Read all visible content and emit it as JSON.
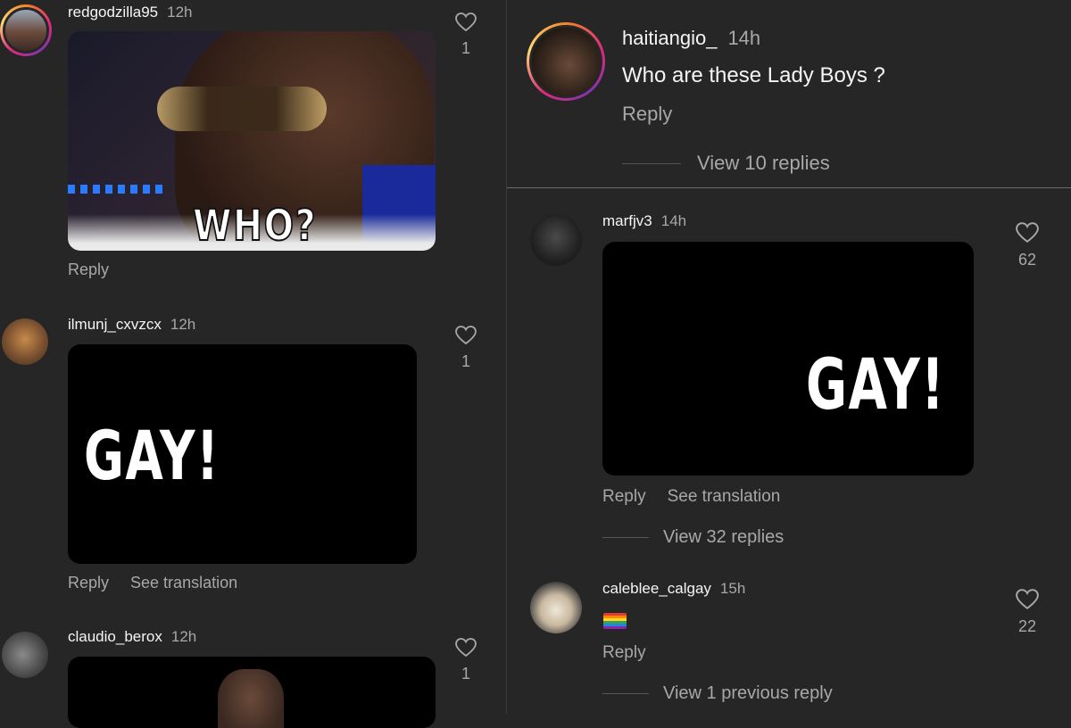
{
  "left_column": {
    "comments": [
      {
        "username": "redgodzilla95",
        "time": "12h",
        "gif_text": "WHO?",
        "actions": [
          "Reply"
        ],
        "likes": "1"
      },
      {
        "username": "ilmunj_cxvzcx",
        "time": "12h",
        "gif_text": "GAY!",
        "actions": [
          "Reply",
          "See translation"
        ],
        "likes": "1"
      },
      {
        "username": "claudio_berox",
        "time": "12h",
        "likes": "1"
      }
    ]
  },
  "right_column": {
    "top_comment": {
      "username": "haitiangio_",
      "time": "14h",
      "text": "Who are these Lady Boys ?",
      "actions": [
        "Reply"
      ],
      "view_replies": "View 10 replies"
    },
    "comments": [
      {
        "username": "marfjv3",
        "time": "14h",
        "gif_text": "GAY!",
        "actions": [
          "Reply",
          "See translation"
        ],
        "likes": "62",
        "view_replies": "View 32 replies"
      },
      {
        "username": "caleblee_calgay",
        "time": "15h",
        "emoji": "rainbow-flag",
        "actions": [
          "Reply"
        ],
        "likes": "22",
        "view_replies": "View 1 previous reply"
      }
    ]
  },
  "colors": {
    "background": "#262626",
    "text": "#f5f5f5",
    "muted": "#a8a8a8"
  }
}
